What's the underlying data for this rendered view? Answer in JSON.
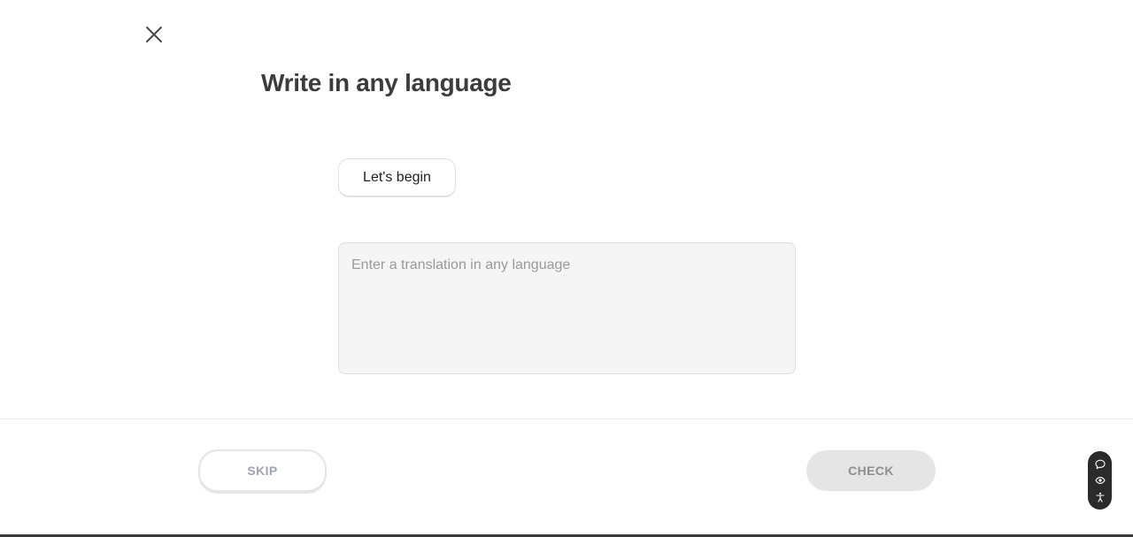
{
  "header": {
    "close_icon": "close-icon",
    "title": "Write in any language"
  },
  "prompt": {
    "chip_label": "Let's begin"
  },
  "answer": {
    "value": "",
    "placeholder": "Enter a translation in any language"
  },
  "footer": {
    "skip_label": "SKIP",
    "check_label": "CHECK",
    "check_enabled": false
  },
  "floating_tools": {
    "icons": [
      "chat-bubble-icon",
      "eye-icon",
      "accessibility-icon"
    ]
  },
  "colors": {
    "title": "#3c3c3c",
    "answer_background": "#f5f5f5",
    "check_background_disabled": "#e5e5e5",
    "skip_text": "#9ea3ad",
    "tools_background": "#2b2b2b"
  }
}
